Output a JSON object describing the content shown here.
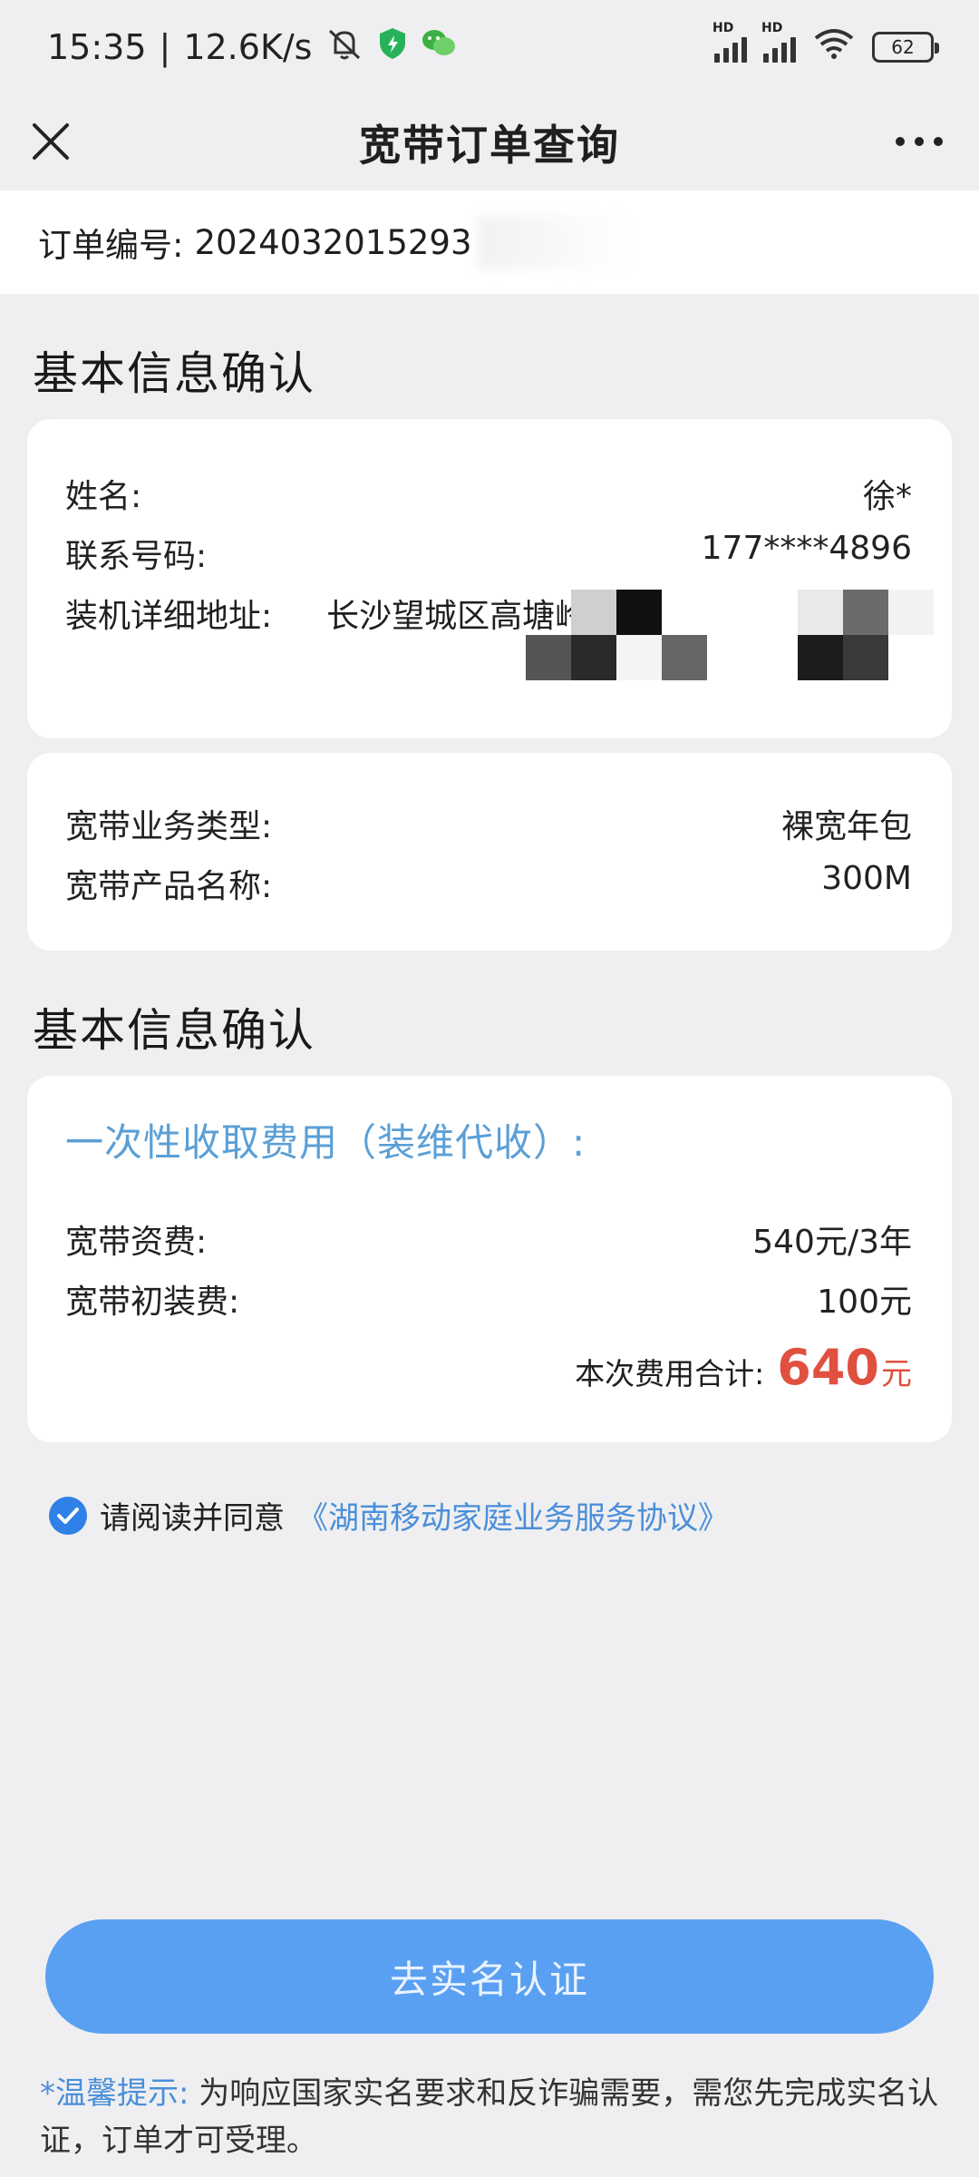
{
  "status_bar": {
    "time": "15:35",
    "speed": "12.6K/s",
    "battery": "62",
    "icons": [
      "mute-bell-icon",
      "shield-icon",
      "wechat-icon",
      "hd-signal-icon",
      "hd-signal-icon",
      "wifi-icon",
      "battery-icon"
    ]
  },
  "header": {
    "title": "宽带订单查询",
    "close_icon": "close-icon",
    "more_icon": "more-dots-icon"
  },
  "order": {
    "label": "订单编号:",
    "number": "2024032015293"
  },
  "section1": {
    "title": "基本信息确认",
    "name_label": "姓名:",
    "name_value": "徐*",
    "phone_label": "联系号码:",
    "phone_value": "177****4896",
    "address_label": "装机详细地址:",
    "address_value": "长沙望城区高塘岭"
  },
  "product": {
    "type_label": "宽带业务类型:",
    "type_value": "裸宽年包",
    "name_label": "宽带产品名称:",
    "name_value": "300M"
  },
  "section2": {
    "title": "基本信息确认",
    "fee_heading": "一次性收取费用（装维代收）:",
    "fee_label": "宽带资费:",
    "fee_value": "540元/3年",
    "install_label": "宽带初装费:",
    "install_value": "100元",
    "total_label": "本次费用合计:",
    "total_amount": "640",
    "total_unit": "元"
  },
  "agreement": {
    "checked": true,
    "text": "请阅读并同意",
    "link": "《湖南移动家庭业务服务协议》"
  },
  "cta": {
    "label": "去实名认证"
  },
  "tip": {
    "label": "*温馨提示:",
    "text": "为响应国家实名要求和反诈骗需要，需您先完成实名认证，订单才可受理。"
  },
  "colors": {
    "accent_blue": "#5aa0f2",
    "link_blue": "#4a8fd9",
    "total_red": "#e0503f",
    "background": "#efeff1"
  }
}
